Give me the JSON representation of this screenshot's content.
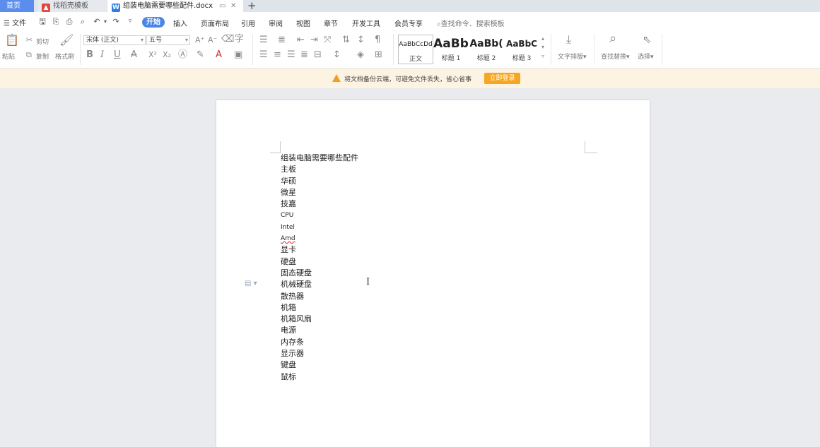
{
  "tabs": {
    "home": "首页",
    "template": "找稻壳模板",
    "document": "组装电脑需要哪些配件.docx",
    "new_tab": "+"
  },
  "menu": {
    "file": "文件",
    "tabs": [
      "开始",
      "插入",
      "页面布局",
      "引用",
      "审阅",
      "视图",
      "章节",
      "开发工具",
      "会员专享"
    ],
    "search_placeholder": "查找命令、搜索模板"
  },
  "ribbon": {
    "clipboard": {
      "paste": "粘贴",
      "cut": "剪切",
      "copy": "复制",
      "format_painter": "格式刷"
    },
    "font_name": "宋体 (正文)",
    "font_size": "五号",
    "styles": [
      {
        "sample": "AaBbCcDd",
        "name": "正文"
      },
      {
        "sample": "AaBb",
        "name": "标题 1"
      },
      {
        "sample": "AaBb(",
        "name": "标题 2"
      },
      {
        "sample": "AaBbC",
        "name": "标题 3"
      }
    ],
    "text_layout": "文字排版",
    "find_replace": "查找替换",
    "select": "选择"
  },
  "notice": {
    "text": "将文档备份云端，可避免文件丢失，省心省事",
    "button": "立即登录"
  },
  "document": {
    "lines": [
      "组装电脑需要哪些配件",
      "主板",
      "华硕",
      "微星",
      "技嘉",
      "CPU",
      "Intel",
      "Amd",
      "显卡",
      "硬盘",
      "固态硬盘",
      "机械硬盘",
      "散热器",
      "机箱",
      "机箱风扇",
      "电源",
      "内存条",
      "显示器",
      "键盘",
      "鼠标"
    ]
  },
  "colors": {
    "accent": "#4a86e8",
    "home_tab": "#5b8def",
    "notice_bg": "#fdf3e3",
    "notice_button": "#f5a623"
  }
}
